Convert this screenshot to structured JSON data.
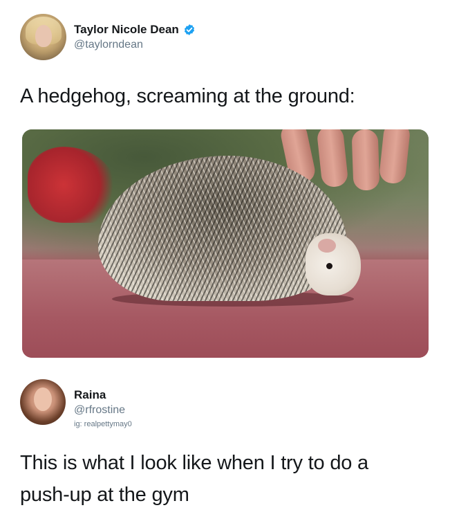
{
  "tweet": {
    "author_name": "Taylor Nicole Dean",
    "author_handle": "@taylorndean",
    "verified_icon": "verified-badge-icon",
    "text": "A hedgehog, screaming at the ground:",
    "image_alt": "hedgehog-photo"
  },
  "reply": {
    "author_name": "Raina",
    "author_handle": "@rfrostine",
    "bio_line": "ig: realpettymay0",
    "text_line1": "This is what I look like when I try to do a",
    "text_line2": "push-up at the gym"
  },
  "colors": {
    "text_primary": "#14171a",
    "text_secondary": "#657786",
    "verified_blue": "#1da1f2",
    "background": "#ffffff"
  }
}
